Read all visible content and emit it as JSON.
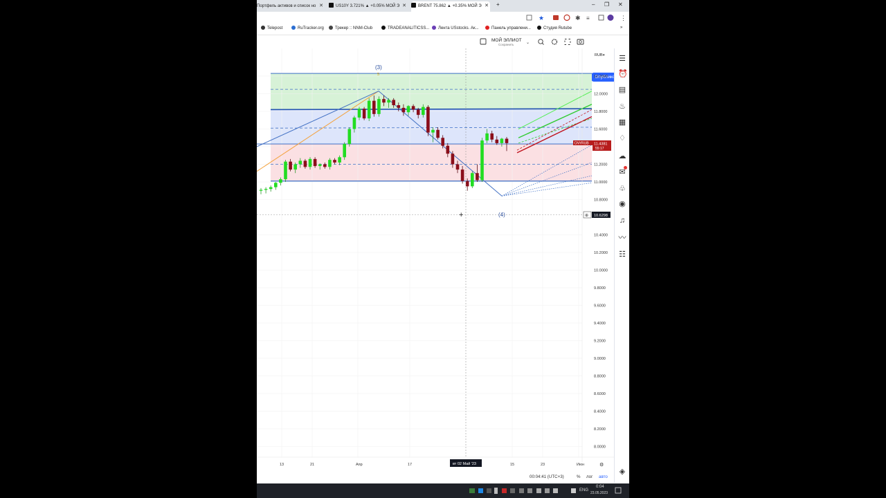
{
  "browser": {
    "tabs": [
      {
        "label": "Портфель активов и список но"
      },
      {
        "label": "US10Y 3.721% ▲ +0.05% МОЙ Э"
      },
      {
        "label": "BRENT 75.862 ▲ +0.35% МОЙ Э"
      }
    ],
    "new_tab": "+",
    "bookmarks": [
      {
        "label": "Telepost",
        "color": "#333333"
      },
      {
        "label": "RuTracker.org",
        "color": "#2b6ed1"
      },
      {
        "label": "Трекер :: NNM-Club",
        "color": "#444444"
      },
      {
        "label": "TRADEANALITICSS...",
        "color": "#111111"
      },
      {
        "label": "Лента USstocks. Ак...",
        "color": "#6a3fb5"
      },
      {
        "label": "Панель управлени...",
        "color": "#e02020"
      },
      {
        "label": "Студия Rutube",
        "color": "#111111"
      }
    ],
    "bookmarks_more": "»"
  },
  "toolbar": {
    "layout_name": "МОЙ ЭЛЛИОТ",
    "layout_status": "Сохранить",
    "publish_label": "Опубликовать",
    "currency": "RUB"
  },
  "chart_data": {
    "type": "candlestick",
    "symbol": "CNYRUB",
    "last_price": "11.4381",
    "countdown": "55:17",
    "crosshair_price": "10.6298",
    "crosshair_date": "вт 02 Май '23",
    "y_ticks": [
      "12.2000",
      "12.0000",
      "11.8000",
      "11.6000",
      "11.4000",
      "11.2000",
      "11.0000",
      "10.8000",
      "10.4000",
      "10.2000",
      "10.0000",
      "9.8000",
      "9.6000",
      "9.4000",
      "9.2000",
      "9.0000",
      "8.8000",
      "8.6000",
      "8.4000",
      "8.2000",
      "8.0000"
    ],
    "x_ticks": [
      "13",
      "21",
      "Апр",
      "17",
      "15",
      "23",
      "Июн"
    ],
    "wave_labels": [
      "(3)",
      "(4)"
    ],
    "ylim": [
      7.95,
      12.35
    ],
    "colors": {
      "up": "#22dd22",
      "down": "#8b0e1a",
      "accent": "#2962ff",
      "green_zone": "#d7f2d7",
      "blue_zone": "#dde5fb",
      "red_zone": "#fbe0e3"
    },
    "candles": [
      [
        10.9,
        10.93,
        10.86,
        10.91
      ],
      [
        10.91,
        10.94,
        10.87,
        10.92
      ],
      [
        10.92,
        10.96,
        10.89,
        10.94
      ],
      [
        10.94,
        11.0,
        10.91,
        10.99
      ],
      [
        10.99,
        11.05,
        10.96,
        11.03
      ],
      [
        11.03,
        11.25,
        11.0,
        11.23
      ],
      [
        11.23,
        11.26,
        11.12,
        11.14
      ],
      [
        11.14,
        11.22,
        11.1,
        11.2
      ],
      [
        11.2,
        11.27,
        11.16,
        11.24
      ],
      [
        11.24,
        11.26,
        11.15,
        11.17
      ],
      [
        11.17,
        11.28,
        11.14,
        11.26
      ],
      [
        11.26,
        11.28,
        11.16,
        11.18
      ],
      [
        11.18,
        11.21,
        11.14,
        11.2
      ],
      [
        11.2,
        11.22,
        11.15,
        11.17
      ],
      [
        11.17,
        11.27,
        11.14,
        11.25
      ],
      [
        11.25,
        11.27,
        11.2,
        11.22
      ],
      [
        11.22,
        11.3,
        11.19,
        11.28
      ],
      [
        11.28,
        11.45,
        11.25,
        11.43
      ],
      [
        11.43,
        11.62,
        11.4,
        11.6
      ],
      [
        11.6,
        11.75,
        11.56,
        11.73
      ],
      [
        11.73,
        11.85,
        11.7,
        11.83
      ],
      [
        11.83,
        11.85,
        11.7,
        11.72
      ],
      [
        11.72,
        11.95,
        11.69,
        11.92
      ],
      [
        11.92,
        11.98,
        11.74,
        11.77
      ],
      [
        11.77,
        11.97,
        11.74,
        11.94
      ],
      [
        11.94,
        11.98,
        11.86,
        11.9
      ],
      [
        11.9,
        11.95,
        11.84,
        11.93
      ],
      [
        11.93,
        11.95,
        11.84,
        11.87
      ],
      [
        11.87,
        11.9,
        11.8,
        11.84
      ],
      [
        11.84,
        11.88,
        11.75,
        11.79
      ],
      [
        11.79,
        11.87,
        11.75,
        11.86
      ],
      [
        11.86,
        11.88,
        11.79,
        11.82
      ],
      [
        11.82,
        11.84,
        11.72,
        11.76
      ],
      [
        11.76,
        11.88,
        11.73,
        11.85
      ],
      [
        11.85,
        11.87,
        11.52,
        11.56
      ],
      [
        11.56,
        11.62,
        11.45,
        11.59
      ],
      [
        11.59,
        11.62,
        11.48,
        11.5
      ],
      [
        11.5,
        11.53,
        11.38,
        11.41
      ],
      [
        11.41,
        11.44,
        11.28,
        11.32
      ],
      [
        11.32,
        11.35,
        11.16,
        11.2
      ],
      [
        11.2,
        11.24,
        11.1,
        11.14
      ],
      [
        11.14,
        11.18,
        10.98,
        11.01
      ],
      [
        11.01,
        11.04,
        10.9,
        10.95
      ],
      [
        10.95,
        11.12,
        10.93,
        11.1
      ],
      [
        11.1,
        11.2,
        11.0,
        11.02
      ],
      [
        11.02,
        11.5,
        11.0,
        11.47
      ],
      [
        11.47,
        11.6,
        11.44,
        11.55
      ],
      [
        11.55,
        11.58,
        11.45,
        11.48
      ],
      [
        11.48,
        11.52,
        11.42,
        11.44
      ],
      [
        11.44,
        11.5,
        11.4,
        11.49
      ],
      [
        11.49,
        11.51,
        11.35,
        11.44
      ]
    ]
  },
  "status_bar": {
    "clock": "00:04:41 (UTC+3)",
    "percent": "%",
    "log": "лог",
    "auto": "авто"
  },
  "taskbar": {
    "lang": "ENG",
    "time": "0:04",
    "date": "23.05.2023"
  }
}
